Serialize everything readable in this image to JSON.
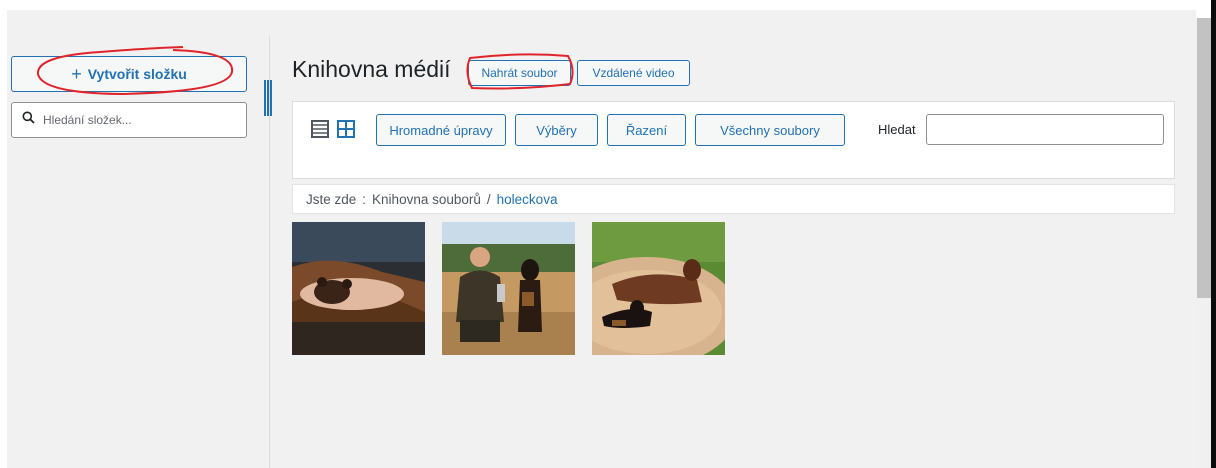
{
  "sidebar": {
    "create_folder_label": "Vytvořit složku",
    "create_folder_icon": "plus-icon",
    "folder_search_placeholder": "Hledání složek...",
    "folder_search_icon": "search-icon"
  },
  "header": {
    "title": "Knihovna médií",
    "upload_label": "Nahrát soubor",
    "remote_video_label": "Vzdálené video"
  },
  "toolbar": {
    "list_view_icon": "list-view-icon",
    "grid_view_icon": "grid-view-icon",
    "bulk_edit_label": "Hromadné úpravy",
    "selection_label": "Výběry",
    "sort_label": "Řazení",
    "all_files_label": "Všechny soubory",
    "search_label": "Hledat",
    "search_value": ""
  },
  "breadcrumb": {
    "prefix": "Jste zde",
    "separator1": ":",
    "root": "Knihovna souborů",
    "separator2": "/",
    "current": "holeckova"
  },
  "thumbnails": [
    {
      "subject": "dog-paw-in-hand"
    },
    {
      "subject": "man-with-dog-and-trophy"
    },
    {
      "subject": "two-dogs-on-wooden-deck"
    }
  ],
  "colors": {
    "accent": "#2271b1",
    "annotation": "#e0242b",
    "background": "#f1f1f1"
  }
}
